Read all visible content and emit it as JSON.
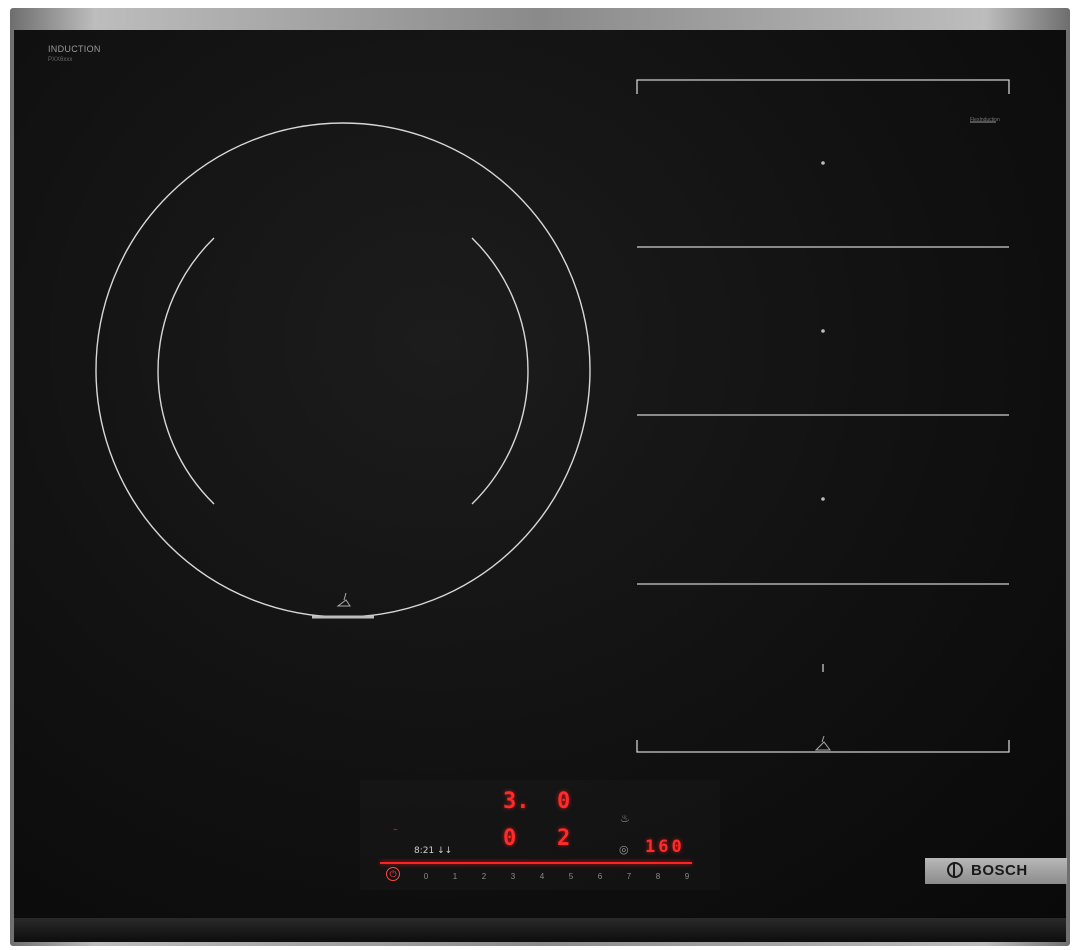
{
  "hob": {
    "title": "INDUCTION",
    "subtitle": "PXX6xxx",
    "flex_zone_label": "FlexInduction"
  },
  "display": {
    "zone_front_left_level": "3.",
    "zone_front_right_level": "0",
    "zone_rear_left_level": "0",
    "zone_rear_right_level": "2",
    "timer_value": "160",
    "small_text": "8:21 ↓↓",
    "flex_indicator": "⁻"
  },
  "slider": {
    "numbers": [
      "0",
      "1",
      "2",
      "3",
      "4",
      "5",
      "6",
      "7",
      "8",
      "9"
    ]
  },
  "icons": {
    "power": "⏻",
    "timer": "◎",
    "sensor": "♨"
  },
  "brand": {
    "name": "BOSCH"
  },
  "colors": {
    "display_red": "#ff2a2a",
    "glass": "#111111",
    "line": "#cfcfcf",
    "frame": "#a8a8a8"
  }
}
